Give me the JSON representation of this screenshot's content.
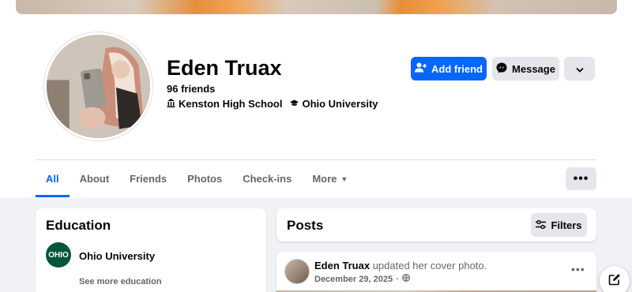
{
  "profile": {
    "name": "Eden Truax",
    "friends": "96 friends",
    "high_school": "Kenston High School",
    "university": "Ohio University",
    "high_school_icon": "school-building-icon",
    "university_icon": "graduation-cap-icon"
  },
  "actions": {
    "add_friend": "Add friend",
    "message": "Message",
    "add_friend_icon": "add-person-icon",
    "message_icon": "messenger-icon",
    "more_icon": "chevron-down-icon",
    "accent": "#0866ff"
  },
  "tabs": [
    {
      "label": "All",
      "active": true
    },
    {
      "label": "About"
    },
    {
      "label": "Friends"
    },
    {
      "label": "Photos"
    },
    {
      "label": "Check-ins"
    },
    {
      "label": "More"
    }
  ],
  "education": {
    "title": "Education",
    "school": "Ohio University",
    "logo_text": "OHIO",
    "see_more": "See more education"
  },
  "posts": {
    "title": "Posts",
    "filters": "Filters",
    "post": {
      "author": "Eden Truax",
      "action": "updated her cover photo.",
      "date": "December 29, 2025",
      "privacy_icon": "globe-icon"
    }
  }
}
